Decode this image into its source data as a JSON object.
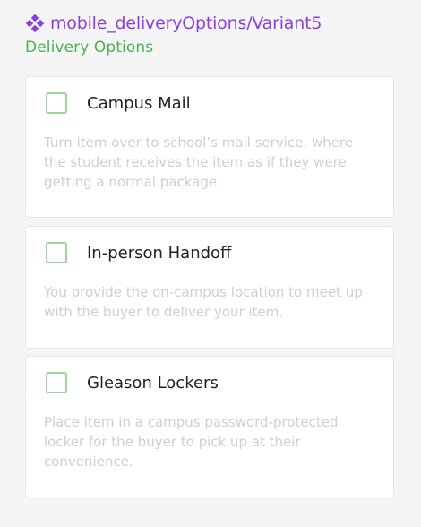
{
  "header": {
    "component_name": "mobile_deliveryOptions/Variant5",
    "icon": "component-diamond-icon",
    "accent_color": "#8b3fe0"
  },
  "section": {
    "title": "Delivery Options",
    "title_color": "#4caf50"
  },
  "options": [
    {
      "label": "Campus Mail",
      "description": "Turn item over to school’s mail service, where the student receives the item as if they were getting a normal package.",
      "checked": false
    },
    {
      "label": "In-person Handoff",
      "description": "You provide the on-campus location to meet up with the buyer to deliver your item.",
      "checked": false
    },
    {
      "label": "Gleason Lockers",
      "description": "Place item in a campus password-protected locker for the buyer to pick up at their convenience.",
      "checked": false
    }
  ]
}
